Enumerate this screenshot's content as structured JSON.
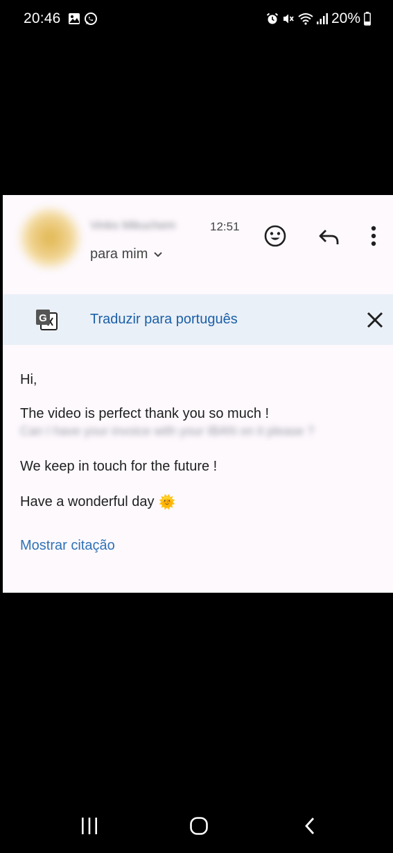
{
  "status_bar": {
    "time": "20:46",
    "battery": "20%"
  },
  "email": {
    "sender_name": "Vinks Mikuchem",
    "time": "12:51",
    "recipient": "para mim",
    "translate_link": "Traduzir para português",
    "greeting": "Hi,",
    "line_1": "The video is perfect thank you so much !",
    "line_blurred": "Can I have your invoice with your IBAN on it please ?",
    "line_3": "We keep in touch for the future !",
    "line_4": "Have a wonderful day",
    "line_4_emoji": "🌞",
    "show_quote": "Mostrar citação"
  },
  "colors": {
    "link": "#1a5fa8",
    "translate_bar": "#eaf0f7",
    "card_background": "#fdf9fd"
  }
}
